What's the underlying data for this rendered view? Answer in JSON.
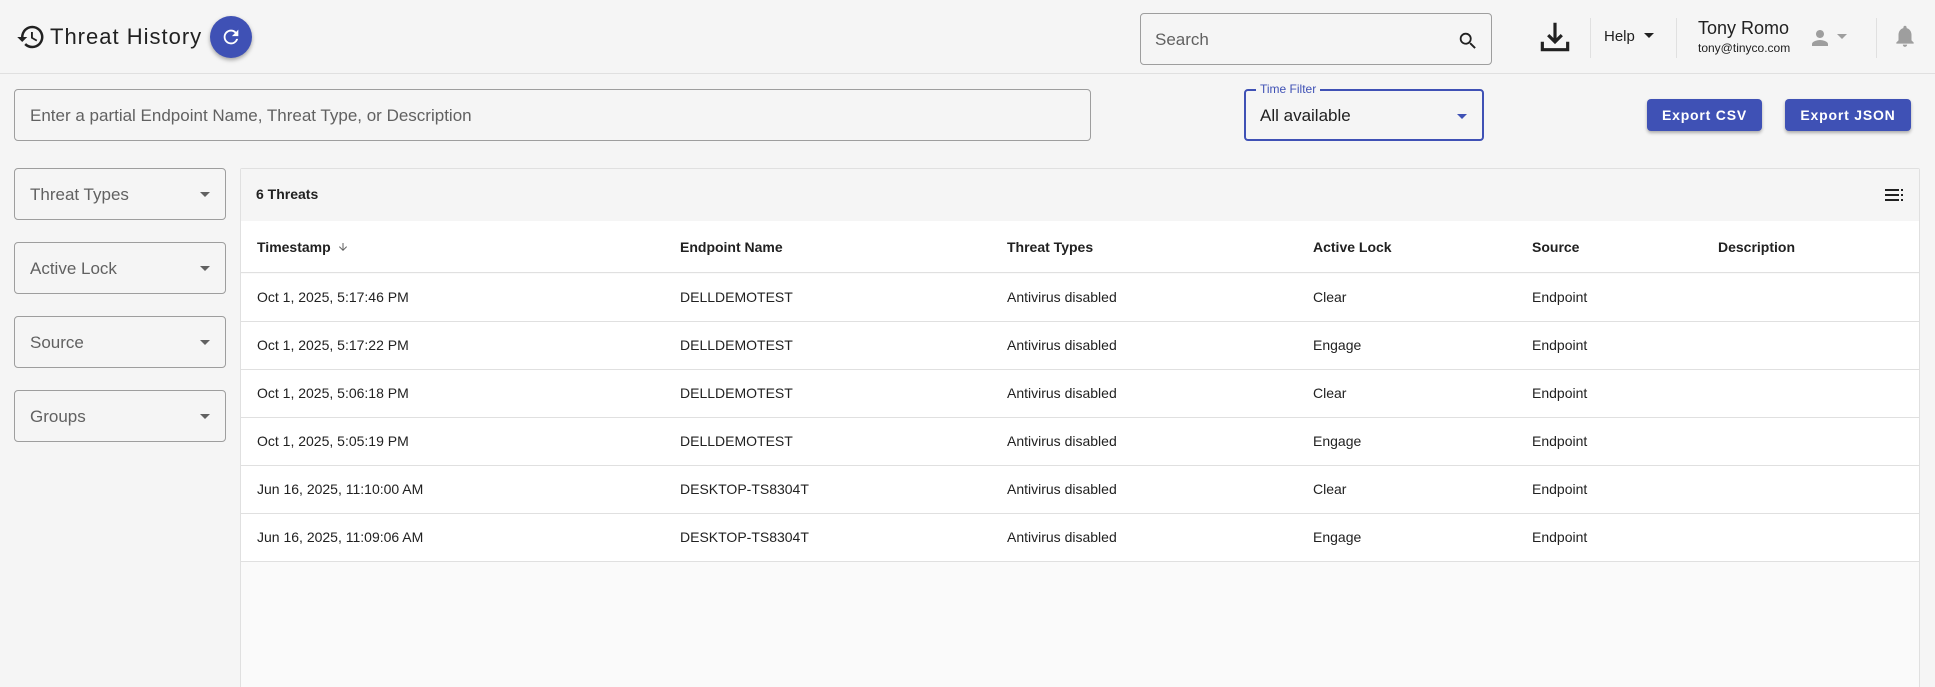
{
  "header": {
    "title": "Threat History",
    "search_placeholder": "Search",
    "help_label": "Help",
    "user_name": "Tony Romo",
    "user_email": "tony@tinyco.com"
  },
  "filters": {
    "query_placeholder": "Enter a partial Endpoint Name, Threat Type, or Description",
    "time_filter_label": "Time Filter",
    "time_filter_value": "All available",
    "export_csv": "Export CSV",
    "export_json": "Export JSON",
    "side": [
      "Threat Types",
      "Active Lock",
      "Source",
      "Groups"
    ]
  },
  "table": {
    "count": "6 Threats",
    "columns": [
      "Timestamp",
      "Endpoint Name",
      "Threat Types",
      "Active Lock",
      "Source",
      "Description"
    ],
    "rows": [
      [
        "Oct 1, 2025, 5:17:46 PM",
        "DELLDEMOTEST",
        "Antivirus disabled",
        "Clear",
        "Endpoint",
        ""
      ],
      [
        "Oct 1, 2025, 5:17:22 PM",
        "DELLDEMOTEST",
        "Antivirus disabled",
        "Engage",
        "Endpoint",
        ""
      ],
      [
        "Oct 1, 2025, 5:06:18 PM",
        "DELLDEMOTEST",
        "Antivirus disabled",
        "Clear",
        "Endpoint",
        ""
      ],
      [
        "Oct 1, 2025, 5:05:19 PM",
        "DELLDEMOTEST",
        "Antivirus disabled",
        "Engage",
        "Endpoint",
        ""
      ],
      [
        "Jun 16, 2025, 11:10:00 AM",
        "DESKTOP-TS8304T",
        "Antivirus disabled",
        "Clear",
        "Endpoint",
        ""
      ],
      [
        "Jun 16, 2025, 11:09:06 AM",
        "DESKTOP-TS8304T",
        "Antivirus disabled",
        "Engage",
        "Endpoint",
        ""
      ]
    ]
  },
  "icons": {
    "history": "history-icon",
    "refresh": "refresh-icon",
    "search": "search-icon",
    "download": "download-icon",
    "help_caret": "chevron-down-icon",
    "avatar": "person-icon",
    "bell": "bell-icon",
    "sort": "arrow-down-icon",
    "columns": "list-icon"
  },
  "colors": {
    "accent": "#3f51b5",
    "background": "#f5f5f5",
    "border": "#9e9e9e"
  }
}
